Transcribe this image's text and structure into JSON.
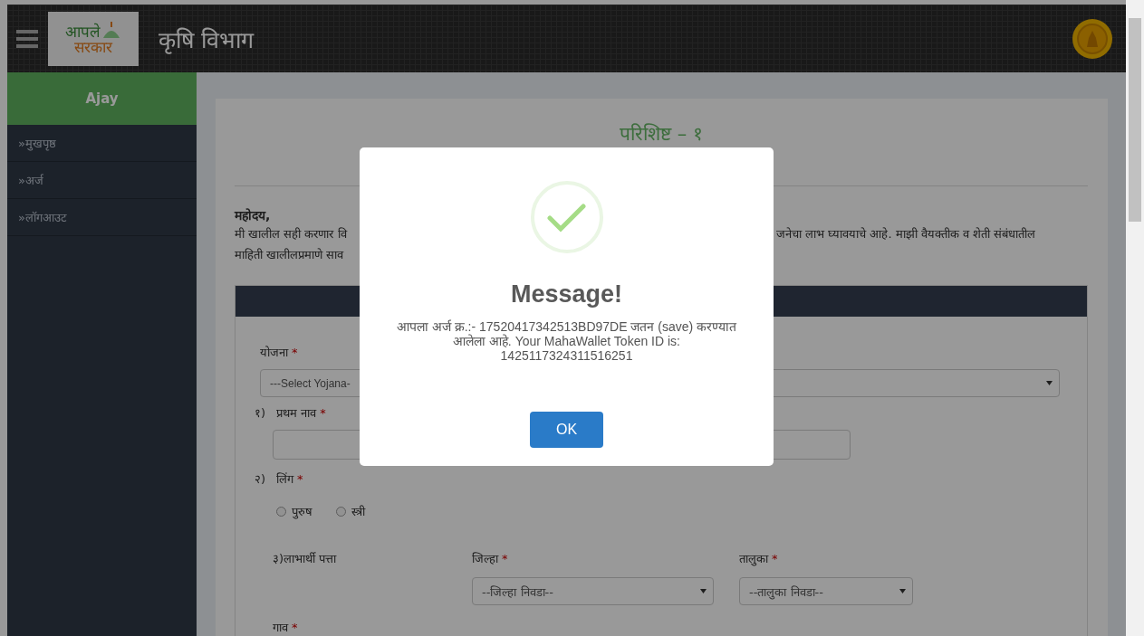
{
  "header": {
    "logo_text": [
      "आपले",
      "सरकार"
    ],
    "title": "कृषि विभाग"
  },
  "sidebar": {
    "user": "Ajay",
    "items": [
      {
        "label": "»मुखपृष्ठ"
      },
      {
        "label": "»अर्ज"
      },
      {
        "label": "»लॉगआउट"
      }
    ]
  },
  "page": {
    "title": "परिशिष्ट – १",
    "salutation": "महोदय,",
    "paragraph_left": [
      "मी खालील सही करणार वि",
      "माहिती खालीलप्रमाणे साव"
    ],
    "paragraph_right": "जनेचा लाभ घ्यावयाचे आहे. माझी वैयक्तीक व शेती संबंधातील"
  },
  "form": {
    "scheme": {
      "label": "योजना",
      "mark": "*",
      "value": "---Select Yojana-"
    },
    "first_name": {
      "number": "१)",
      "label": "प्रथम नाव",
      "mark": "*"
    },
    "gender": {
      "number": "२)",
      "label": "लिंग",
      "mark": "*",
      "options": [
        {
          "label": "पुरुष",
          "selected": false
        },
        {
          "label": "स्त्री",
          "selected": false
        }
      ]
    },
    "address": {
      "label": "३)लाभार्थी पत्ता",
      "district": {
        "label": "जिल्हा",
        "mark": "*",
        "value": "--जिल्हा निवडा--"
      },
      "taluka": {
        "label": "तालुका",
        "mark": "*",
        "value": "--तालुका निवडा--"
      }
    },
    "village": {
      "label": "गाव",
      "mark": "*"
    }
  },
  "modal": {
    "title": "Message!",
    "message": "आपला अर्ज क्र.:- 17520417342513BD97DE जतन (save) करण्यात आलेला आहे. Your MahaWallet Token ID is: 1425117324311516251",
    "button": "OK"
  }
}
